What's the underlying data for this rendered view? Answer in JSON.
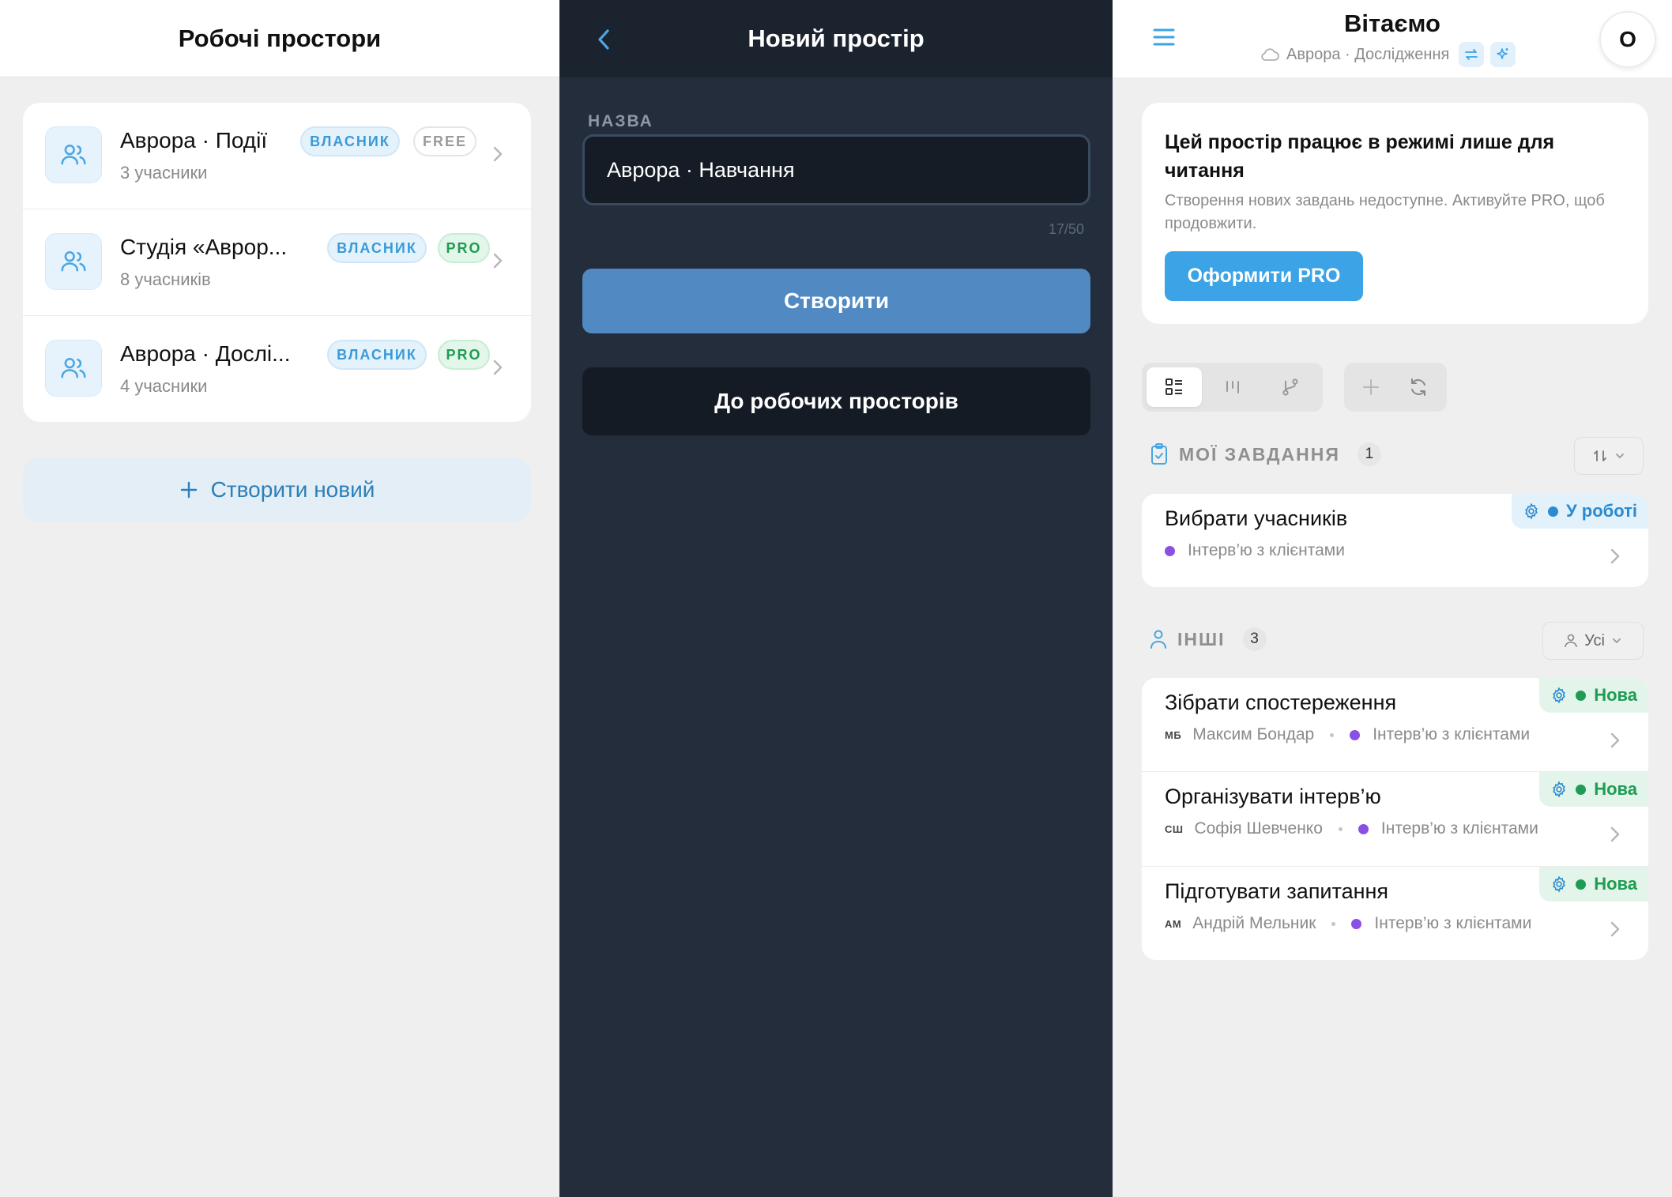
{
  "workspaces": {
    "title": "Робочі простори",
    "items": [
      {
        "name": "Аврора · Події",
        "members": "3 учасники",
        "role": "ВЛАСНИК",
        "plan": "FREE"
      },
      {
        "name": "Студія «Аврор...",
        "members": "8 учасників",
        "role": "ВЛАСНИК",
        "plan": "PRO"
      },
      {
        "name": "Аврора · Дослі...",
        "members": "4 учасники",
        "role": "ВЛАСНИК",
        "plan": "PRO"
      }
    ],
    "create_new": "Створити новий"
  },
  "new_space": {
    "title": "Новий простір",
    "name_label": "НАЗВА",
    "name_value": "Аврора · Навчання",
    "counter": "17/50",
    "create_button": "Створити",
    "back_button": "До робочих просторів"
  },
  "dashboard": {
    "title": "Вітаємо",
    "workspace": "Аврора · Дослідження",
    "avatar": "О",
    "readonly": {
      "title": "Цей простір працює в режимі лише для читання",
      "description": "Створення нових завдань недоступне. Активуйте PRO, щоб продовжити.",
      "button": "Оформити PRO"
    },
    "my_tasks": {
      "label": "МОЇ ЗАВДАННЯ",
      "count": "1",
      "items": [
        {
          "title": "Вибрати учасників",
          "project": "Інтерв’ю з клієнтами",
          "status": "У роботі"
        }
      ]
    },
    "others": {
      "label": "ІНШІ",
      "count": "3",
      "filter": "Усі",
      "items": [
        {
          "title": "Зібрати спостереження",
          "initials": "МБ",
          "assignee": "Максим Бондар",
          "project": "Інтерв’ю з клієнтами",
          "status": "Нова"
        },
        {
          "title": "Організувати інтерв’ю",
          "initials": "СШ",
          "assignee": "Софія Шевченко",
          "project": "Інтерв’ю з клієнтами",
          "status": "Нова"
        },
        {
          "title": "Підготувати запитання",
          "initials": "АМ",
          "assignee": "Андрій Мельник",
          "project": "Інтерв’ю з клієнтами",
          "status": "Нова"
        }
      ]
    }
  },
  "colors": {
    "accent": "#3ba3e6",
    "dark_bg": "#232d3b",
    "status_in_progress": "#2b8ad0",
    "status_new": "#1f9c51",
    "project_dot": "#8a4fe3"
  }
}
